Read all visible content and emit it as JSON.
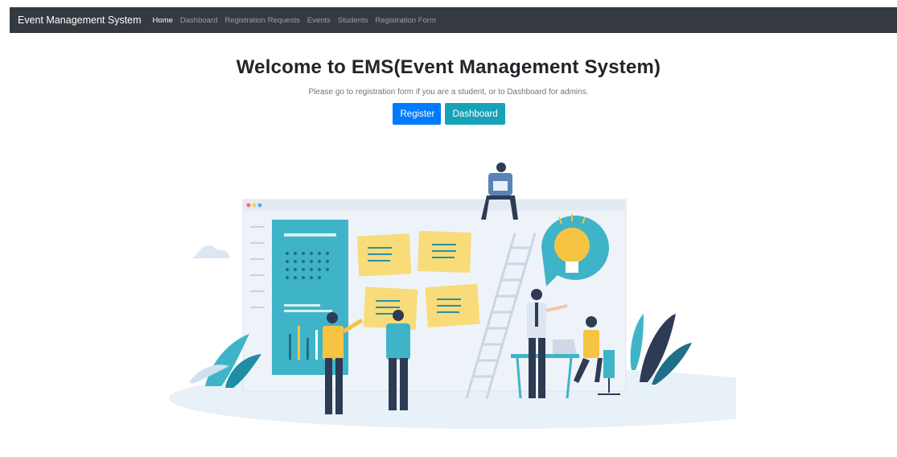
{
  "navbar": {
    "brand": "Event Management System",
    "links": [
      "Home",
      "Dashboard",
      "Registration Requests",
      "Events",
      "Students",
      "Registration Form"
    ],
    "bg_color": "#343a40"
  },
  "hero": {
    "title": "Welcome to EMS(Event Management System)",
    "subtitle": "Please go to registration form if you are a student, or to Dashboard for admins.",
    "register_label": "Register",
    "dashboard_label": "Dashboard",
    "register_color": "#007bff",
    "dashboard_color": "#17a2b8"
  },
  "illustration": {
    "icon": "team-working-illustration"
  }
}
